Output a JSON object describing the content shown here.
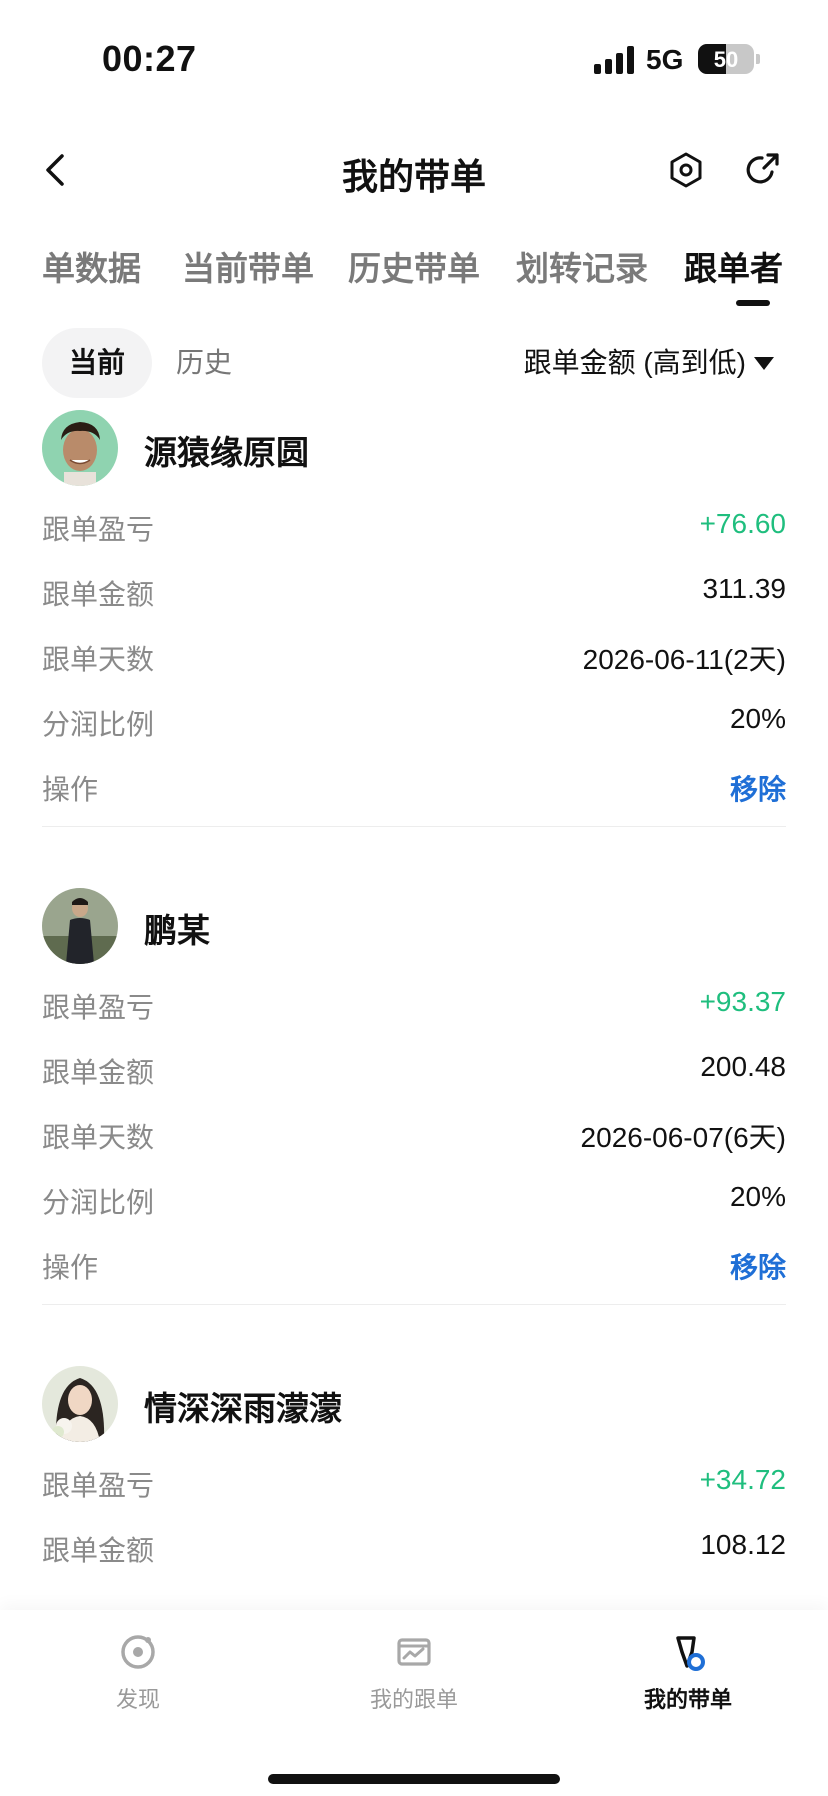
{
  "status_bar": {
    "time": "00:27",
    "network": "5G",
    "battery": "50",
    "battery_level": 0.5
  },
  "header": {
    "title": "我的带单",
    "back_icon": "chevron-left-icon",
    "settings_icon": "hexagon-settings-icon",
    "share_icon": "share-icon"
  },
  "tabs": [
    {
      "label": "单数据",
      "active": false
    },
    {
      "label": "当前带单",
      "active": false
    },
    {
      "label": "历史带单",
      "active": false
    },
    {
      "label": "划转记录",
      "active": false
    },
    {
      "label": "跟单者",
      "active": true
    }
  ],
  "subtabs": {
    "current": "当前",
    "history": "历史",
    "sort_label": "跟单金额 (高到低)"
  },
  "colors": {
    "profit": "#1fbe7e",
    "link": "#1f6fd6"
  },
  "followers": [
    {
      "name": "源猿缘原圆",
      "rows": [
        {
          "label": "跟单盈亏",
          "value": "+76.60"
        },
        {
          "label": "跟单金额",
          "value": "311.39"
        },
        {
          "label": "跟单天数",
          "value": "2026-06-11(2天)"
        },
        {
          "label": "分润比例",
          "value": "20%"
        },
        {
          "label": "操作",
          "value": "移除"
        }
      ]
    },
    {
      "name": "鹏某",
      "rows": [
        {
          "label": "跟单盈亏",
          "value": "+93.37"
        },
        {
          "label": "跟单金额",
          "value": "200.48"
        },
        {
          "label": "跟单天数",
          "value": "2026-06-07(6天)"
        },
        {
          "label": "分润比例",
          "value": "20%"
        },
        {
          "label": "操作",
          "value": "移除"
        }
      ]
    },
    {
      "name": "情深深雨濛濛",
      "rows": [
        {
          "label": "跟单盈亏",
          "value": "+34.72"
        },
        {
          "label": "跟单金额",
          "value": "108.12"
        }
      ]
    }
  ],
  "bottom_nav": [
    {
      "label": "发现",
      "icon": "discover-icon",
      "active": false
    },
    {
      "label": "我的跟单",
      "icon": "chart-icon",
      "active": false
    },
    {
      "label": "我的带单",
      "icon": "lead-trade-icon",
      "active": true
    }
  ]
}
